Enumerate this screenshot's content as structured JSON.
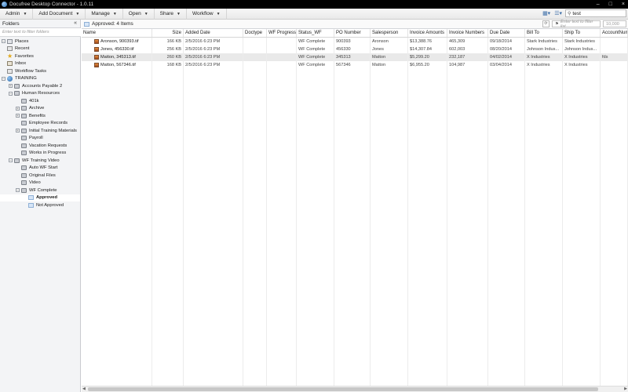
{
  "window": {
    "title": "Docufree Desktop Connector - 1.0.11",
    "controls": [
      "–",
      "□",
      "×"
    ]
  },
  "menubar": {
    "menus": [
      "Admin",
      "Add Document",
      "Manage",
      "Open",
      "Share",
      "Workflow"
    ],
    "search_value": "test"
  },
  "left_panel": {
    "title": "Folders",
    "collapse_glyph": "«",
    "filter_placeholder": "Enter text to filter folders",
    "places": {
      "label": "Places",
      "items": [
        "Recent",
        "Favorites",
        "Inbox",
        "Workflow Tasks"
      ]
    },
    "training": {
      "label": "TRAINING",
      "accounts_payable": "Accounts Payable 2",
      "human_resources": {
        "label": "Human Resources",
        "children": [
          "401k",
          "Archive",
          "Benefits",
          "Employee Records",
          "Initial Training Materials",
          "Payroll",
          "Vacation Requests",
          "Works in Progress"
        ]
      },
      "wf_training": {
        "label": "WF Training Video",
        "children": [
          "Auto WF Start",
          "Original Files",
          "Video"
        ],
        "wf_complete": {
          "label": "WF Complete",
          "children": [
            "Approved",
            "Not Approved"
          ]
        }
      }
    }
  },
  "main": {
    "breadcrumb": "Approved:  4 Items",
    "filter_placeholder": "Enter text to filter list",
    "page_size": "10,000",
    "columns": [
      "Name",
      "Size",
      "Added Date",
      "Doctype",
      "WF Progress",
      "Status_WF",
      "PO Number",
      "Salesperson",
      "Invoice Amounts",
      "Invoice Numbers",
      "Due Date",
      "Bill To",
      "Ship To",
      "AccountNum"
    ],
    "rows": [
      [
        "Aronson, 900393.tif",
        "166 KB",
        "2/5/2016 6:23 PM",
        "",
        "",
        "WF Complete",
        "900393",
        "Aronson",
        "$13,388.76",
        "465,309",
        "09/18/2014",
        "Stark Industries",
        "Stark Industries",
        ""
      ],
      [
        "Jones, 456330.tif",
        "256 KB",
        "2/5/2016 6:23 PM",
        "",
        "",
        "WF Complete",
        "456330",
        "Jones",
        "$14,307.84",
        "602,003",
        "08/20/2014",
        "Johnson Indus...",
        "Johnson Indus...",
        ""
      ],
      [
        "Matton, 345313.tif",
        "260 KB",
        "2/5/2016 6:23 PM",
        "",
        "",
        "WF Complete",
        "345313",
        "Matton",
        "$5,299.20",
        "232,187",
        "04/02/2014",
        "X Industries",
        "X Industries",
        "fds"
      ],
      [
        "Matton, 567346.tif",
        "168 KB",
        "2/5/2016 6:23 PM",
        "",
        "",
        "WF Complete",
        "567346",
        "Matton",
        "$6,955.20",
        "104,987",
        "03/04/2014",
        "X Industries",
        "X Industries",
        ""
      ]
    ],
    "highlighted_row": 2
  }
}
